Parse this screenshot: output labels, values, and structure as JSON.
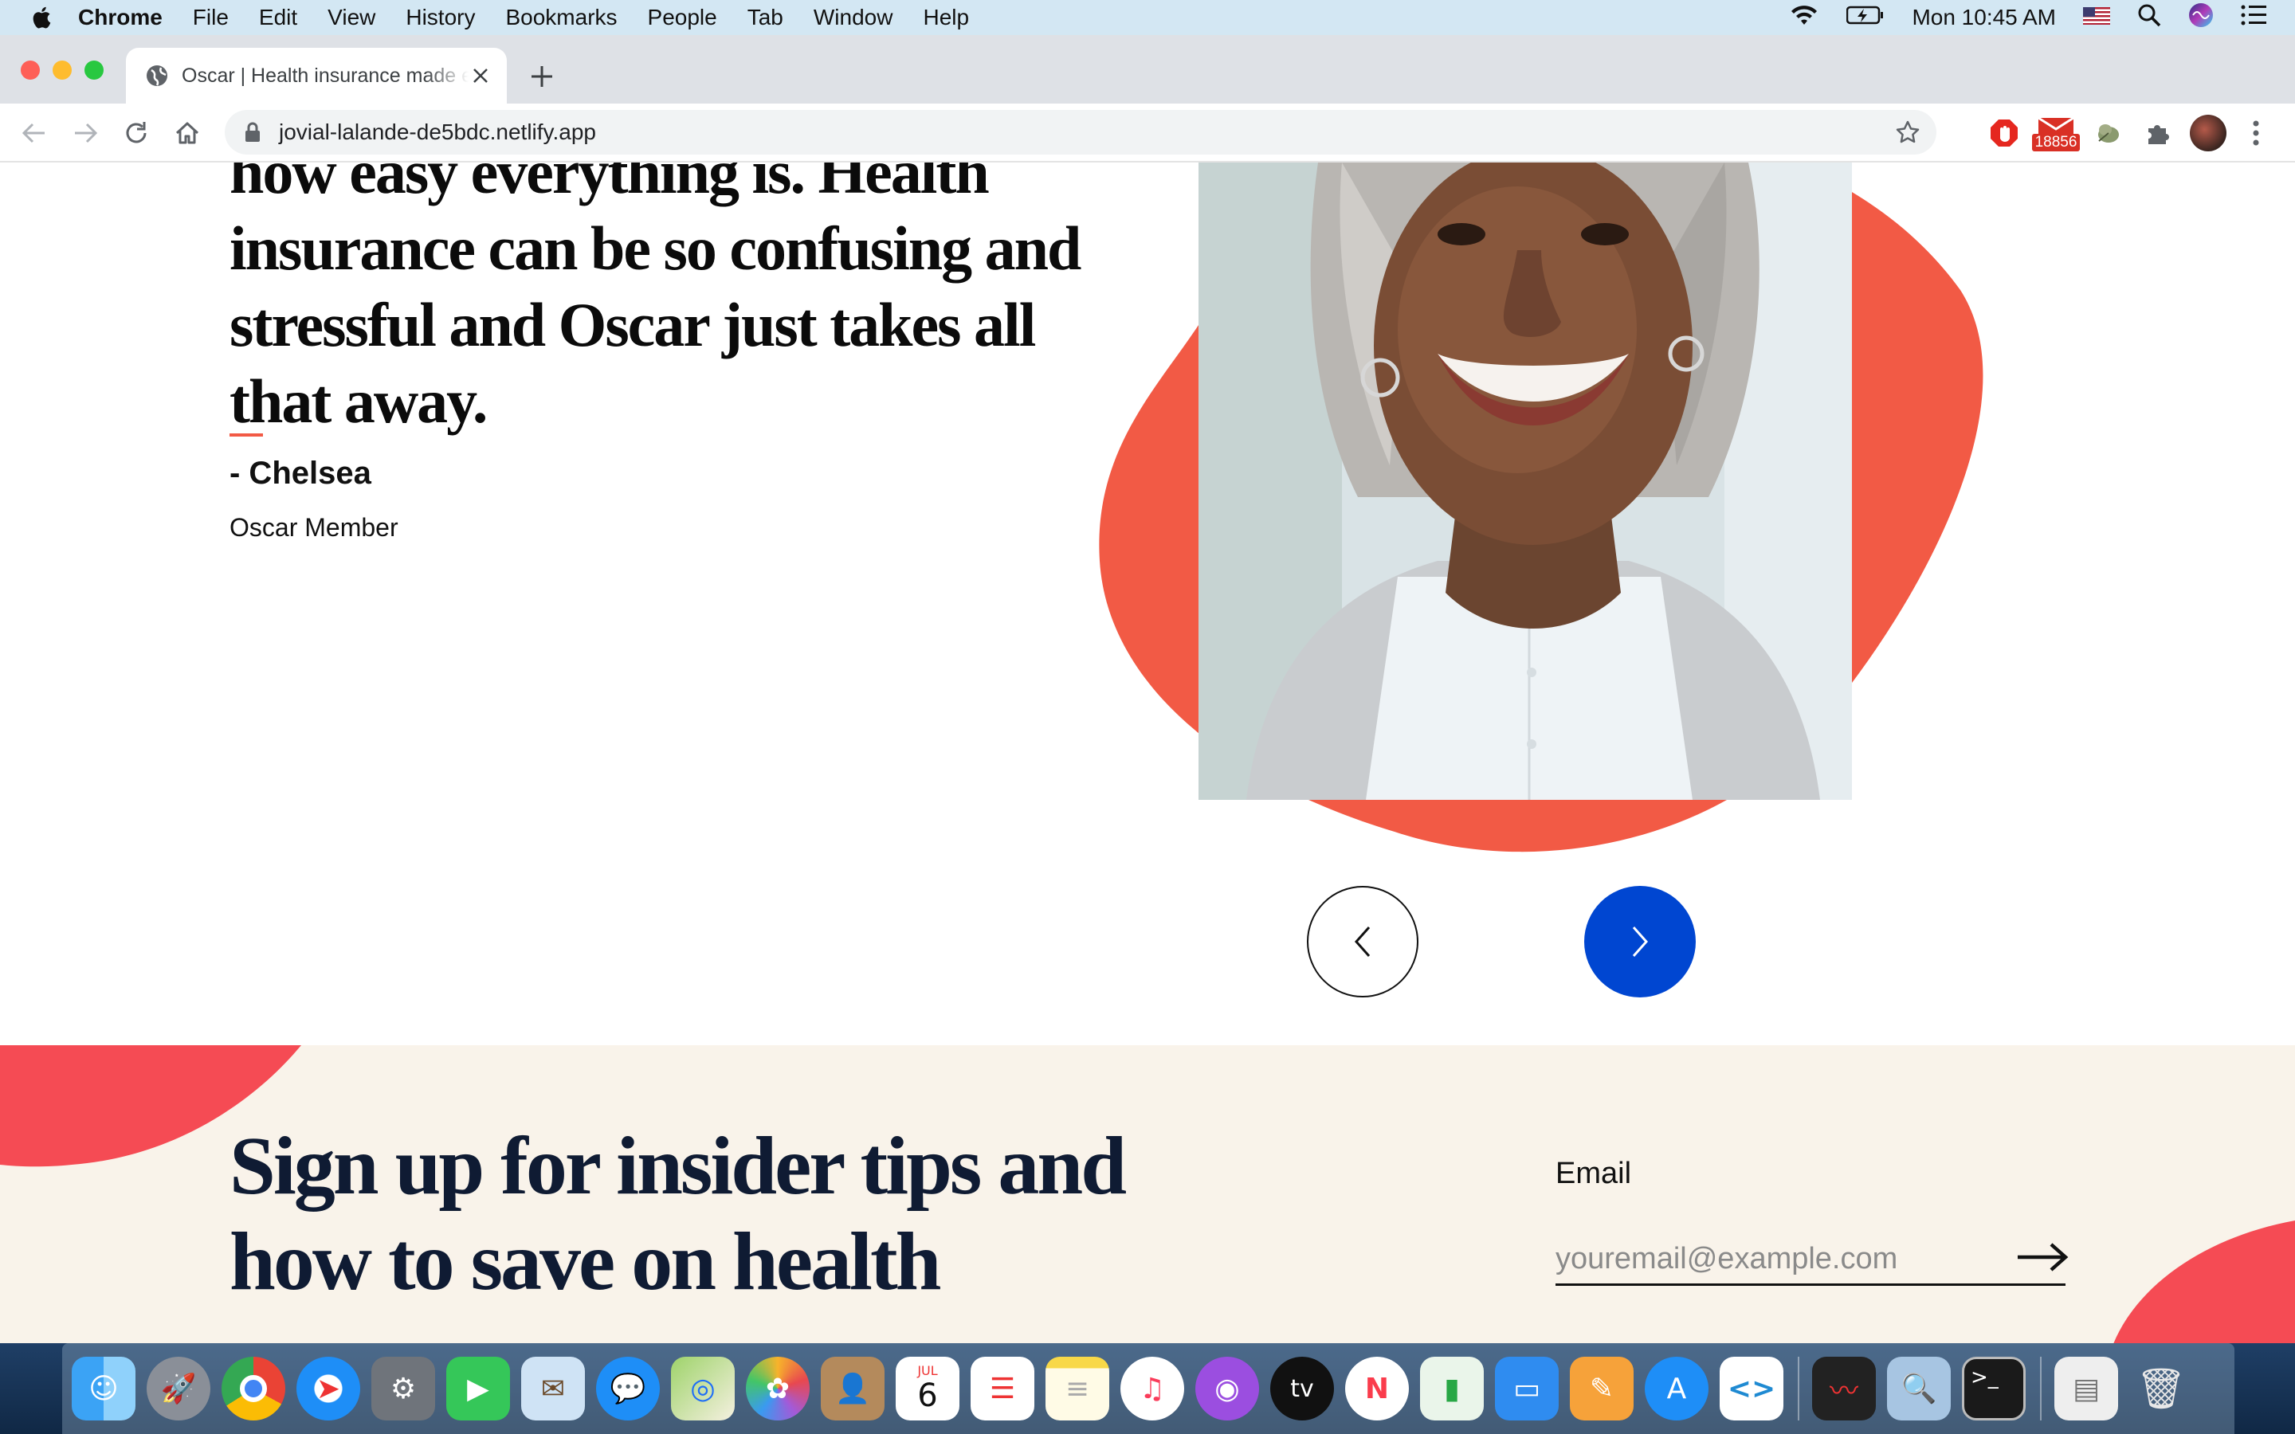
{
  "menubar": {
    "app_name": "Chrome",
    "items": [
      "File",
      "Edit",
      "View",
      "History",
      "Bookmarks",
      "People",
      "Tab",
      "Window",
      "Help"
    ],
    "clock": "Mon 10:45 AM"
  },
  "browser": {
    "tab_title": "Oscar | Health insurance made easy",
    "url": "jovial-lalande-de5bdc.netlify.app",
    "mail_badge": "18856"
  },
  "testimonial": {
    "quote_lines": [
      "how easy everything is. Health",
      "insurance can be so confusing and",
      "stressful and Oscar just takes all",
      "that away."
    ],
    "author": "- Chelsea",
    "role": "Oscar Member"
  },
  "signup": {
    "title_lines": [
      "Sign up for insider tips and",
      "how to save on health"
    ],
    "email_label": "Email",
    "email_placeholder": "youremail@example.com"
  },
  "colors": {
    "accent_coral": "#f25a45",
    "next_button_blue": "#0046d1",
    "signup_bg": "#f9f3ea",
    "signup_blob": "#f54b54",
    "title_navy": "#0f1b33"
  },
  "dock": {
    "calendar_month": "JUL",
    "calendar_day": "6",
    "tv_label": "tv",
    "apps": [
      "finder-icon",
      "launchpad-icon",
      "chrome-icon",
      "safari-icon",
      "system-preferences-icon",
      "facetime-icon",
      "mail-icon",
      "messages-icon",
      "maps-icon",
      "photos-icon",
      "contacts-icon",
      "calendar-icon",
      "reminders-icon",
      "notes-icon",
      "music-icon",
      "podcasts-icon",
      "apple-tv-icon",
      "news-icon",
      "numbers-icon",
      "keynote-icon",
      "pages-icon",
      "app-store-icon",
      "vscode-icon",
      "voice-memos-icon",
      "preview-icon",
      "terminal-icon",
      "documents-icon",
      "trash-icon"
    ]
  }
}
